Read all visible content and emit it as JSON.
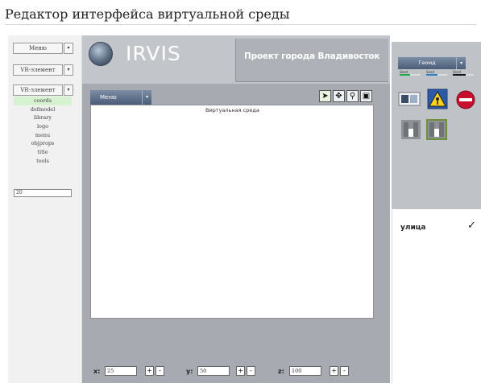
{
  "page": {
    "title": "Редактор интерфейса виртуальной среды"
  },
  "left_panel": {
    "buttons": [
      {
        "label": "Меню",
        "arrow": "▾"
      },
      {
        "label": "VR-элемент",
        "arrow": "▾"
      },
      {
        "label": "VR-элемент",
        "arrow": "▾"
      }
    ],
    "list": [
      "coords",
      "defmodel",
      "library",
      "logo",
      "menu",
      "objprops",
      "title",
      "tools"
    ],
    "selected_index": 0,
    "input_value": "20"
  },
  "header": {
    "logo_text": "IRVIS",
    "project_title": "Проект города Владивосток"
  },
  "workspace": {
    "menu_label": "Меню",
    "menu_arrow": "▾",
    "canvas_label": "Виртуальная среда",
    "tools": [
      {
        "icon": "pointer-icon",
        "glyph": "➤"
      },
      {
        "icon": "move-icon",
        "glyph": "✥"
      },
      {
        "icon": "zoom-icon",
        "glyph": "⚲"
      },
      {
        "icon": "window-icon",
        "glyph": "▣"
      }
    ]
  },
  "coords": {
    "x_label": "x:",
    "x_value": "25",
    "y_label": "y:",
    "y_value": "50",
    "z_label": "z:",
    "z_value": "100",
    "plus": "+",
    "minus": "-"
  },
  "right_panel": {
    "geometry_label": "Геомд",
    "geometry_arrow": "▾",
    "sliders": [
      {
        "label": "Seed",
        "color": "#1fa84a",
        "level": 0.5
      },
      {
        "label": "Seed",
        "color": "#2a7fc4",
        "level": 0.55
      },
      {
        "label": "Seed",
        "color": "#111111",
        "level": 0.6
      }
    ],
    "property_label": "улица",
    "property_checked": "✓"
  }
}
